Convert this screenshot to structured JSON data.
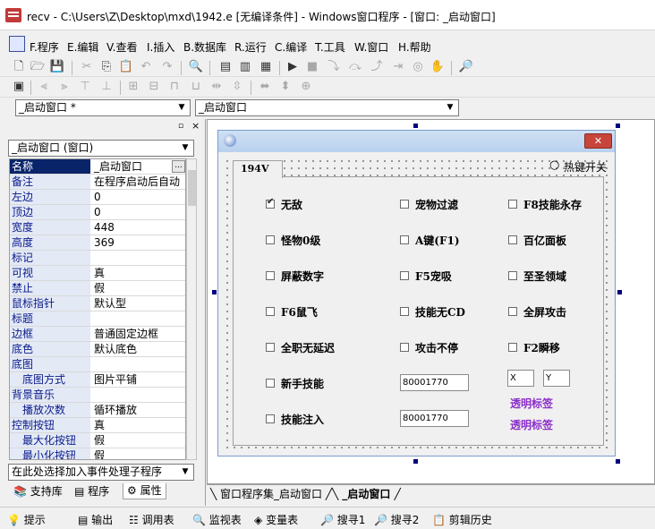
{
  "window": {
    "title": "recv - C:\\Users\\Z\\Desktop\\mxd\\1942.e [无编译条件] - Windows窗口程序 - [窗口: _启动窗口]"
  },
  "menu": [
    "F.程序",
    "E.编辑",
    "V.查看",
    "I.插入",
    "B.数据库",
    "R.运行",
    "C.编译",
    "T.工具",
    "W.窗口",
    "H.帮助"
  ],
  "selectors": {
    "window_combo": "_启动窗口 *",
    "event_combo": "_启动窗口",
    "object_combo": "_启动窗口 (窗口)",
    "event_handler_combo": "在此处选择加入事件处理子程序"
  },
  "properties": [
    {
      "name": "名称",
      "value": "_启动窗口",
      "sub": false
    },
    {
      "name": "备注",
      "value": "在程序启动后自动",
      "sub": false
    },
    {
      "name": "左边",
      "value": "0",
      "sub": false
    },
    {
      "name": "顶边",
      "value": "0",
      "sub": false
    },
    {
      "name": "宽度",
      "value": "448",
      "sub": false
    },
    {
      "name": "高度",
      "value": "369",
      "sub": false
    },
    {
      "name": "标记",
      "value": "",
      "sub": false
    },
    {
      "name": "可视",
      "value": "真",
      "sub": false
    },
    {
      "name": "禁止",
      "value": "假",
      "sub": false
    },
    {
      "name": "鼠标指针",
      "value": "默认型",
      "sub": false
    },
    {
      "name": "标题",
      "value": "",
      "sub": false
    },
    {
      "name": "边框",
      "value": "普通固定边框",
      "sub": false
    },
    {
      "name": "底色",
      "value": "默认底色",
      "sub": false
    },
    {
      "name": "底图",
      "value": "",
      "sub": false
    },
    {
      "name": "底图方式",
      "value": "图片平铺",
      "sub": true
    },
    {
      "name": "背景音乐",
      "value": "",
      "sub": false
    },
    {
      "name": "播放次数",
      "value": "循环播放",
      "sub": true
    },
    {
      "name": "控制按钮",
      "value": "真",
      "sub": false
    },
    {
      "name": "最大化按钮",
      "value": "假",
      "sub": true
    },
    {
      "name": "最小化按钮",
      "value": "假",
      "sub": true
    }
  ],
  "left_tabs": [
    "支持库",
    "程序",
    "属性"
  ],
  "designer": {
    "tab_label": "194V",
    "hotkey_label": "热键开关",
    "checkboxes": [
      {
        "label": "无敌",
        "checked": true
      },
      {
        "label": "宠物过滤",
        "checked": false
      },
      {
        "label": "F8技能永存",
        "checked": false
      },
      {
        "label": "怪物0级",
        "checked": false
      },
      {
        "label": "A键(F1)",
        "checked": false
      },
      {
        "label": "百亿面板",
        "checked": false
      },
      {
        "label": "屏蔽数字",
        "checked": false
      },
      {
        "label": "F5宠吸",
        "checked": false
      },
      {
        "label": "至圣领域",
        "checked": false
      },
      {
        "label": "F6鼠飞",
        "checked": false
      },
      {
        "label": "技能无CD",
        "checked": false
      },
      {
        "label": "全屏攻击",
        "checked": false
      },
      {
        "label": "全职无延迟",
        "checked": false
      },
      {
        "label": "攻击不停",
        "checked": false
      },
      {
        "label": "F2瞬移",
        "checked": false
      },
      {
        "label": "新手技能",
        "checked": false
      },
      {
        "label": "技能注入",
        "checked": false
      }
    ],
    "edit_box_1": "80001770",
    "edit_box_2": "80001770",
    "x_box": "X",
    "y_box": "Y",
    "link_1": "透明标签",
    "link_2": "透明标签"
  },
  "doc_tabs": [
    "窗口程序集_启动窗口",
    "_启动窗口"
  ],
  "bottom_tabs": [
    "提示",
    "输出",
    "调用表",
    "监视表",
    "变量表",
    "搜寻1",
    "搜寻2",
    "剪辑历史"
  ],
  "colors": {
    "accent": "#0a246a",
    "link": "#8b2fc9",
    "close": "#c7453b"
  }
}
